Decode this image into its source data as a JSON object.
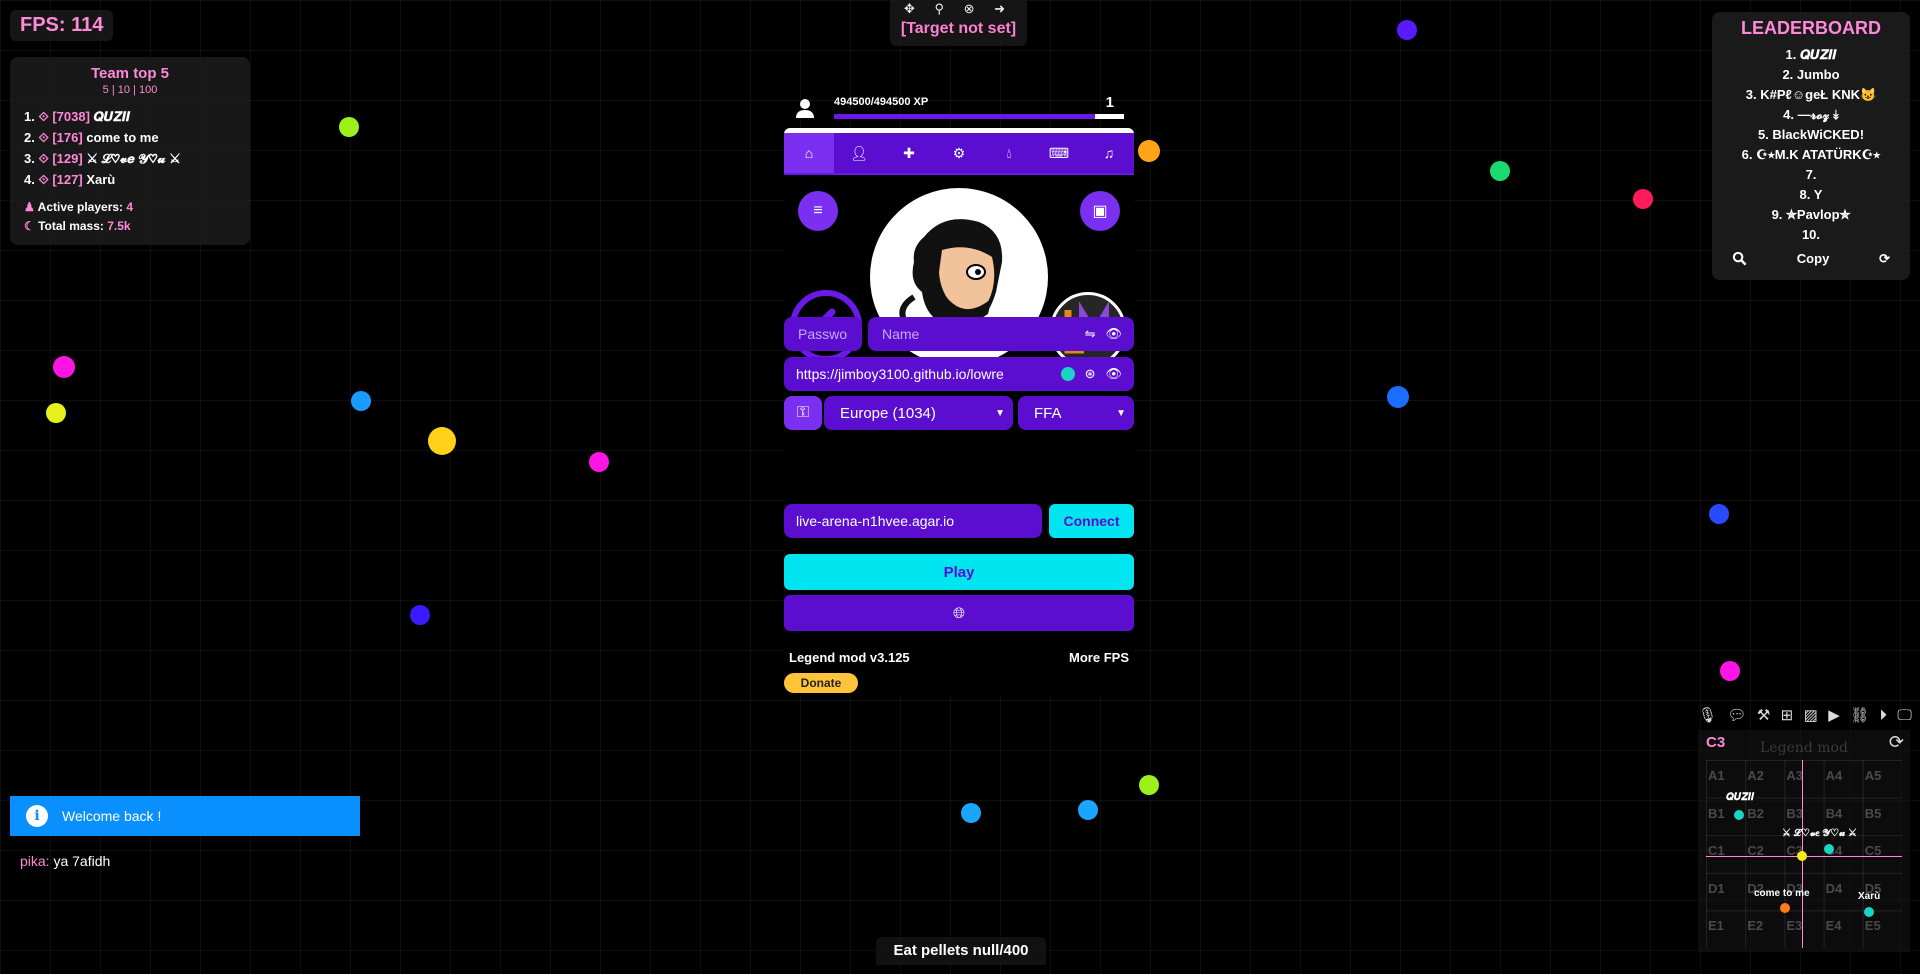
{
  "hud": {
    "fps": "FPS: 114",
    "target_icons": "✥ ⚲ ⊗ ➜",
    "target_label": "[Target not set]",
    "eat_pellets": "Eat pellets null/400"
  },
  "team_top": {
    "title": "Team top 5",
    "subtitle": "5 | 10 | 100",
    "members": [
      {
        "rank": "1.",
        "mass": "[7038]",
        "name": "𝑸𝑼𝒁𝑰𝑰"
      },
      {
        "rank": "2.",
        "mass": "[176]",
        "name": "come to me"
      },
      {
        "rank": "3.",
        "mass": "[129]",
        "name": "⚔ 𝓛♡𝓿𝒆 𝓨♡𝓾 ⚔"
      },
      {
        "rank": "4.",
        "mass": "[127]",
        "name": "Xarù"
      }
    ],
    "active_players_label": "Active players:",
    "active_players": "4",
    "total_mass_label": "Total mass:",
    "total_mass": "7.5k"
  },
  "leaderboard": {
    "title": "LEADERBOARD",
    "entries": [
      "1. 𝑸𝑼𝒁𝑰𝑰",
      "2. Jumbo",
      "3. K#Pℓ☺geŁ KNK😺",
      "4. —𝓻𝓸𝔃 ↡",
      "5. BlackWiCKED!",
      "6. ☪⭑M.K ATATÜRK☪⭑",
      "7.",
      "8. Y",
      "9. ✮Pavlop✮",
      "10."
    ],
    "copy_label": "Copy"
  },
  "profile": {
    "xp_text": "494500/494500 XP",
    "level": "1",
    "xp_progress": 0.9
  },
  "panel": {
    "tabs": [
      "home",
      "user",
      "puzzle",
      "gear",
      "drop",
      "keyboard",
      "music"
    ],
    "password_placeholder": "Password",
    "name_placeholder": "Name",
    "skin_url": "https://jimboy3100.github.io/lowre",
    "region": "Europe (1034)",
    "mode": "FFA",
    "server": "live-arena-n1hvee.agar.io",
    "connect_label": "Connect",
    "play_label": "Play",
    "mod_version": "Legend mod v3.125",
    "more_fps": "More FPS",
    "donate_label": "Donate"
  },
  "notifications": {
    "welcome": "Welcome back !"
  },
  "chat": [
    {
      "nick": "pika:",
      "text": "ya 7afidh"
    }
  ],
  "minimap": {
    "sector": "C3",
    "title": "Legend mod",
    "cells": [
      "A1",
      "A2",
      "A3",
      "A4",
      "A5",
      "B1",
      "B2",
      "B3",
      "B4",
      "B5",
      "C1",
      "C2",
      "C3",
      "C4",
      "C5",
      "D1",
      "D2",
      "D3",
      "D4",
      "D5",
      "E1",
      "E2",
      "E3",
      "E4",
      "E5"
    ],
    "players": [
      {
        "name": "𝑸𝑼𝒁𝑰𝑰",
        "color": "#19d4c4"
      },
      {
        "name": "⚔ 𝓛♡𝓿𝒆 𝓨♡𝓾 ⚔",
        "color": "#19d4c4"
      },
      {
        "name": "come to me",
        "color": "#ff7a1a"
      },
      {
        "name": "Xarù",
        "color": "#19d4c4"
      }
    ],
    "self_color": "#f2ea1a"
  },
  "colors": {
    "accent_purple": "#5b0ecf",
    "accent_cyan": "#00e5f0",
    "pink": "#ff88d8",
    "info_blue": "#0a8fff"
  }
}
